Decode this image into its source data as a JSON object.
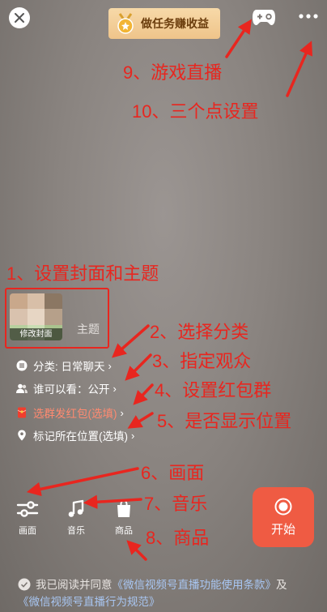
{
  "top": {
    "task_button_label": "做任务赚收益",
    "icons": [
      "close-icon",
      "medal-icon",
      "gamepad-icon",
      "more-dots-icon"
    ]
  },
  "annotations": {
    "a1": "1、设置封面和主题",
    "a2": "2、选择分类",
    "a3": "3、指定观众",
    "a4": "4、设置红包群",
    "a5": "5、是否显示位置",
    "a6": "6、画面",
    "a7": "7、音乐",
    "a8": "8、商品",
    "a9": "9、游戏直播",
    "a10": "10、三个点设置",
    "color": "#e8261f"
  },
  "cover": {
    "caption": "修改封面",
    "theme_placeholder": "主题"
  },
  "options": {
    "category": "分类: 日常聊天",
    "audience": "谁可以看：公开",
    "red_packet": "选群发红包(选填)",
    "location": "标记所在位置(选填)",
    "red_packet_color": "#ff8a70"
  },
  "tools": {
    "picture": "画面",
    "music": "音乐",
    "goods": "商品"
  },
  "start": {
    "label": "开始",
    "color": "#ef5b43"
  },
  "agreement": {
    "prefix": "我已阅读并同意",
    "terms1": "《微信视频号直播功能使用条款》",
    "and": "及",
    "terms2": "《微信视频号直播行为规范》",
    "link_color": "#a8c6f2"
  }
}
